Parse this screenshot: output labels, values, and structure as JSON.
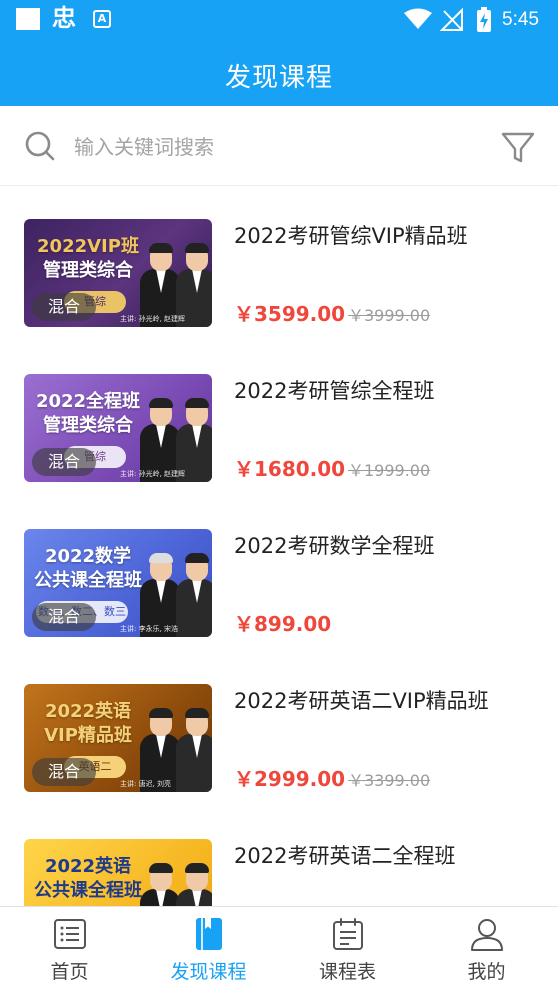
{
  "status_bar": {
    "time": "5:45",
    "app_glyph": "忠",
    "badge": "A"
  },
  "header": {
    "title": "发现课程"
  },
  "search": {
    "placeholder": "输入关键词搜索",
    "value": ""
  },
  "courses": [
    {
      "title": "2022考研管综VIP精品班",
      "price": "￥3599.00",
      "original_price": "￥3999.00",
      "badge": "混合",
      "thumb": {
        "line1": "2022VIP班",
        "line2": "管理类综合",
        "tag": "管综",
        "lecturers": "主讲: 孙光岭, 赵建辉"
      },
      "colors": {
        "bg": "#4a2a6e",
        "accent": "#e3b04b"
      }
    },
    {
      "title": "2022考研管综全程班",
      "price": "￥1680.00",
      "original_price": "￥1999.00",
      "badge": "混合",
      "thumb": {
        "line1": "2022全程班",
        "line2": "管理类综合",
        "tag": "管综",
        "lecturers": "主讲: 孙光岭, 赵建辉"
      },
      "colors": {
        "bg": "#8a5bc0",
        "accent": "#ffffff"
      }
    },
    {
      "title": "2022考研数学全程班",
      "price": "￥899.00",
      "original_price": "",
      "badge": "混合",
      "thumb": {
        "line1": "2022数学",
        "line2": "公共课全程班",
        "tag": "数一、数二、数三",
        "lecturers": "主讲: 李永乐, 宋浩"
      },
      "colors": {
        "bg": "#4c6bde",
        "accent": "#ffffff"
      }
    },
    {
      "title": "2022考研英语二VIP精品班",
      "price": "￥2999.00",
      "original_price": "￥3399.00",
      "badge": "混合",
      "thumb": {
        "line1": "2022英语",
        "line2": "VIP精品班",
        "tag": "英语二",
        "lecturers": "主讲: 唐迟, 刘亮"
      },
      "colors": {
        "bg": "#a3580f",
        "accent": "#f5d27a"
      }
    },
    {
      "title": "2022考研英语二全程班",
      "price": "",
      "original_price": "",
      "badge": "",
      "thumb": {
        "line1": "2022英语",
        "line2": "公共课全程班",
        "tag": "",
        "lecturers": ""
      },
      "colors": {
        "bg": "#f5c23a",
        "accent": "#ffffff"
      }
    }
  ],
  "bottom_nav": {
    "items": [
      {
        "label": "首页",
        "icon": "home-icon",
        "active": false
      },
      {
        "label": "发现课程",
        "icon": "discover-courses-icon",
        "active": true
      },
      {
        "label": "课程表",
        "icon": "schedule-icon",
        "active": false
      },
      {
        "label": "我的",
        "icon": "profile-icon",
        "active": false
      }
    ]
  },
  "colors": {
    "primary": "#17a2f5",
    "price_red": "#f0473c",
    "muted_gray": "#9c9c9c",
    "text_dark": "#222222"
  }
}
